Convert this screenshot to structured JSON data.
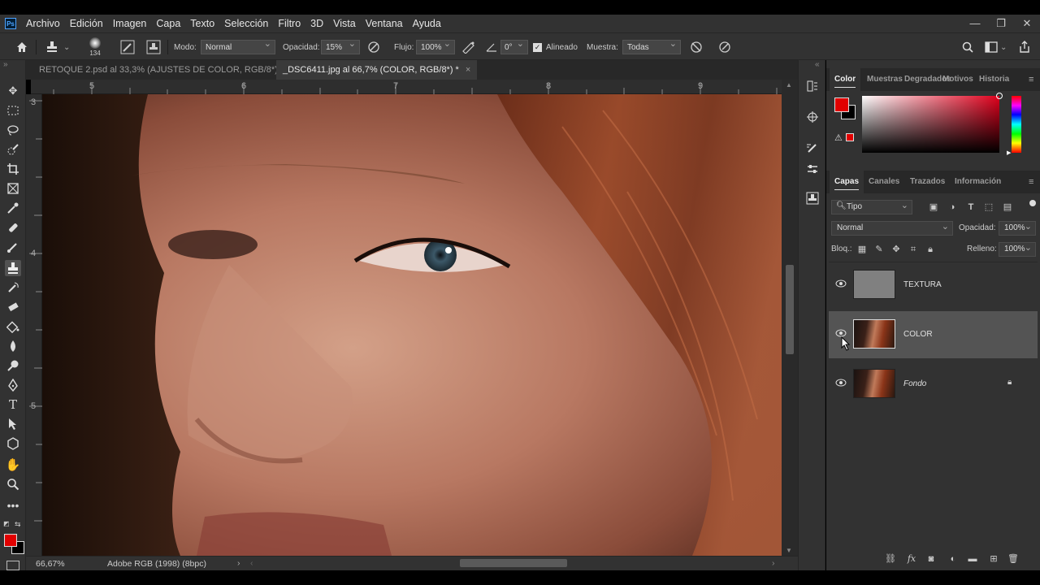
{
  "app": {
    "logo": "Ps"
  },
  "menu": [
    "Archivo",
    "Edición",
    "Imagen",
    "Capa",
    "Texto",
    "Selección",
    "Filtro",
    "3D",
    "Vista",
    "Ventana",
    "Ayuda"
  ],
  "window_controls": [
    "minimize-icon",
    "restore-icon",
    "close-icon"
  ],
  "options_bar": {
    "brush_size": "134",
    "mode_label": "Modo:",
    "mode_value": "Normal",
    "opacity_label": "Opacidad:",
    "opacity_value": "15%",
    "flow_label": "Flujo:",
    "flow_value": "100%",
    "angle_value": "0°",
    "aligned_label": "Alineado",
    "aligned_checked": true,
    "sample_label": "Muestra:",
    "sample_value": "Todas"
  },
  "tabs": [
    {
      "label": "RETOQUE 2.psd al 33,3% (AJUSTES DE COLOR, RGB/8*)",
      "active": false
    },
    {
      "label": "_DSC6411.jpg al 66,7% (COLOR, RGB/8*) *",
      "active": true
    }
  ],
  "rulers": {
    "horizontal": [
      "5",
      "6",
      "7",
      "8",
      "9"
    ],
    "vertical": [
      "3",
      "4",
      "5"
    ]
  },
  "status": {
    "zoom": "66,67%",
    "profile": "Adobe RGB (1998) (8bpc)"
  },
  "colors": {
    "foreground": "#e10000",
    "background": "#000000",
    "ui_dark": "#323232"
  },
  "color_panel": {
    "tabs": [
      "Color",
      "Muestras",
      "Degradados",
      "Motivos",
      "Historia"
    ],
    "active_tab": "Color",
    "hue_color": "#e0001c"
  },
  "layers_panel": {
    "tabs": [
      "Capas",
      "Canales",
      "Trazados",
      "Información"
    ],
    "active_tab": "Capas",
    "filter_value": "Tipo",
    "blend_mode": "Normal",
    "opacity_label": "Opacidad:",
    "opacity_value": "100%",
    "lock_label": "Bloq.:",
    "fill_label": "Relleno:",
    "fill_value": "100%",
    "layers": [
      {
        "name": "TEXTURA",
        "visible": true,
        "selected": false,
        "locked": false,
        "italic": false,
        "thumb": "gray"
      },
      {
        "name": "COLOR",
        "visible": true,
        "selected": true,
        "locked": false,
        "italic": false,
        "thumb": "photo"
      },
      {
        "name": "Fondo",
        "visible": true,
        "selected": false,
        "locked": true,
        "italic": true,
        "thumb": "photo"
      }
    ]
  },
  "toolbar_tools": [
    "move-tool-icon",
    "marquee-tool-icon",
    "lasso-tool-icon",
    "quick-select-tool-icon",
    "crop-tool-icon",
    "frame-tool-icon",
    "eyedropper-tool-icon",
    "healing-brush-tool-icon",
    "brush-tool-icon",
    "clone-stamp-tool-icon",
    "history-brush-tool-icon",
    "eraser-tool-icon",
    "paint-bucket-tool-icon",
    "blur-tool-icon",
    "dodge-tool-icon",
    "pen-tool-icon",
    "type-tool-icon",
    "path-select-tool-icon",
    "shape-tool-icon",
    "hand-tool-icon",
    "zoom-tool-icon",
    "more-tools-icon"
  ]
}
